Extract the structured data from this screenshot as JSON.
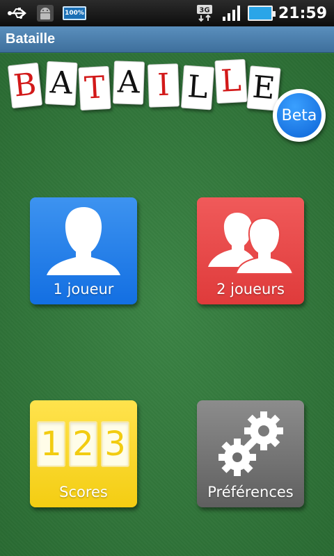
{
  "status_bar": {
    "time": "21:59",
    "battery_small_text": "100%",
    "network_label": "3G",
    "icons": [
      "usb-icon",
      "android-debug-icon",
      "battery-small-icon",
      "network-3g-icon",
      "signal-icon",
      "battery-icon"
    ]
  },
  "title_bar": {
    "title": "Bataille"
  },
  "logo": {
    "letters": [
      "B",
      "A",
      "T",
      "A",
      "I",
      "L",
      "L",
      "E"
    ],
    "beta": "Beta"
  },
  "tiles": {
    "one_player": "1 joueur",
    "two_players": "2 joueurs",
    "scores": "Scores",
    "scores_digits": [
      "1",
      "2",
      "3"
    ],
    "preferences": "Préférences"
  },
  "colors": {
    "felt": "#317d3b",
    "one_player": "#1a76e6",
    "two_players": "#e84848",
    "scores": "#f7d420",
    "preferences": "#737373",
    "beta": "#0d63d6",
    "title_bar": "#4a7fae"
  }
}
